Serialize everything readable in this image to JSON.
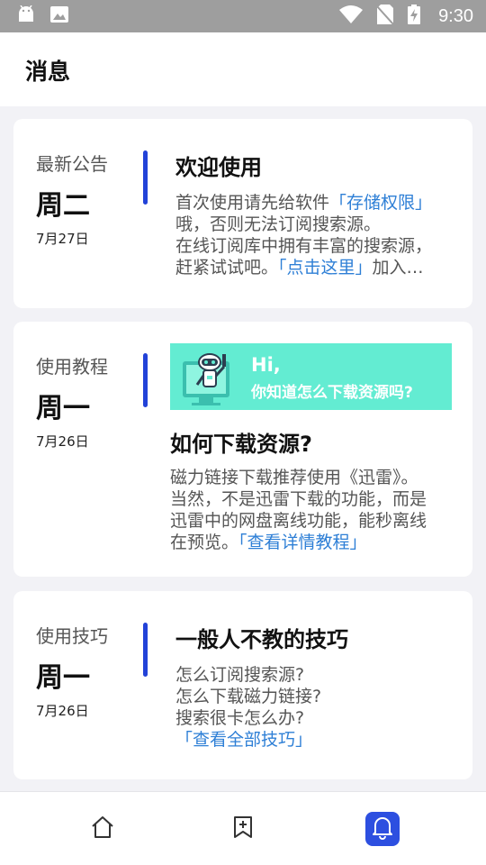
{
  "status_bar": {
    "time": "9:30",
    "icons": [
      "android-icon",
      "image-icon",
      "wifi-icon",
      "no-sim-icon",
      "battery-charging-icon"
    ]
  },
  "header": {
    "title": "消息"
  },
  "cards": [
    {
      "category": "最新公告",
      "weekday": "周二",
      "date": "7月27日",
      "title": "欢迎使用",
      "body": {
        "l1_text": "首次使用请先给软件",
        "l1_link": "「存储权限」",
        "l2_text": "哦，否则无法订阅搜索源。",
        "l3_text": "在线订阅库中拥有丰富的搜索源，",
        "l4_text": "赶紧试试吧。",
        "l4_link": "「点击这里」",
        "l4_tail": "加入…"
      }
    },
    {
      "category": "使用教程",
      "weekday": "周一",
      "date": "7月26日",
      "banner": {
        "hi": "Hi,",
        "subtitle": "你知道怎么下载资源吗?"
      },
      "title": "如何下载资源?",
      "body": {
        "l1_text": "磁力链接下载推荐使用《迅雷》。",
        "l2_text": "当然，不是迅雷下载的功能，而是",
        "l3_text": "迅雷中的网盘离线功能，能秒离线",
        "l4_text": "在预览。",
        "l4_link": "「查看详情教程」"
      }
    },
    {
      "category": "使用技巧",
      "weekday": "周一",
      "date": "7月26日",
      "title": "一般人不教的技巧",
      "body": {
        "l1_text": "怎么订阅搜索源?",
        "l2_text": "怎么下载磁力链接?",
        "l3_text": "搜索很卡怎么办?",
        "l4_link": "「查看全部技巧」"
      }
    }
  ],
  "bottom_nav": {
    "items": [
      {
        "icon": "home-icon",
        "active": false
      },
      {
        "icon": "bookmark-add-icon",
        "active": false
      },
      {
        "icon": "bell-icon",
        "active": true
      }
    ]
  },
  "colors": {
    "accent": "#2242d8",
    "link": "#2e7fd6",
    "banner": "#63ecd2",
    "nav_active": "#2d4fe0"
  }
}
